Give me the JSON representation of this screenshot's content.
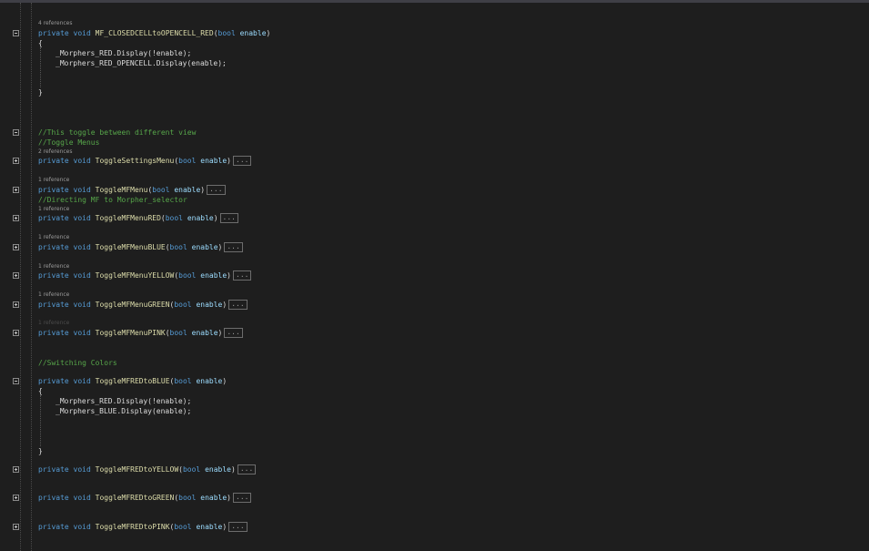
{
  "editor": {
    "ref_4": "4 references",
    "ref_2": "2 references",
    "ref_1": "1 reference",
    "kw_private": "private",
    "kw_void": "void",
    "kw_bool": "bool",
    "param_enable": "enable",
    "ellipsis": "...",
    "brace_open": "{",
    "brace_close": "}",
    "fn_closed_to_open": "MF_CLOSEDCELLtoOPENCELL_RED",
    "stmt_red_display_not": "_Morphers_RED.Display(!enable);",
    "stmt_red_opencell_display": "_Morphers_RED_OPENCELL.Display(enable);",
    "comment_toggle_view": "//This toggle between different view",
    "comment_toggle_menus": "//Toggle Menus",
    "fn_toggle_settings": "ToggleSettingsMenu",
    "fn_toggle_mf_menu": "ToggleMFMenu",
    "comment_directing": "//Directing MF to Morpher_selector",
    "fn_toggle_red": "ToggleMFMenuRED",
    "fn_toggle_blue": "ToggleMFMenuBLUE",
    "fn_toggle_yellow": "ToggleMFMenuYELLOW",
    "fn_toggle_green": "ToggleMFMenuGREEN",
    "fn_toggle_pink": "ToggleMFMenuPINK",
    "comment_switching": "//Switching Colors",
    "fn_red_to_blue": "ToggleMFREDtoBLUE",
    "stmt_blue_display": "_Morphers_BLUE.Display(enable);",
    "fn_red_to_yellow": "ToggleMFREDtoYELLOW",
    "fn_red_to_green": "ToggleMFREDtoGREEN",
    "fn_red_to_pink": "ToggleMFREDtoPINK"
  },
  "colors": {
    "background": "#1e1e1e",
    "keyword": "#569cd6",
    "function": "#dcdcaa",
    "comment": "#57a64a",
    "parameter": "#9cdcfe"
  },
  "icons": {
    "fold_expanded": "minus-box-icon",
    "fold_collapsed": "plus-box-icon"
  }
}
